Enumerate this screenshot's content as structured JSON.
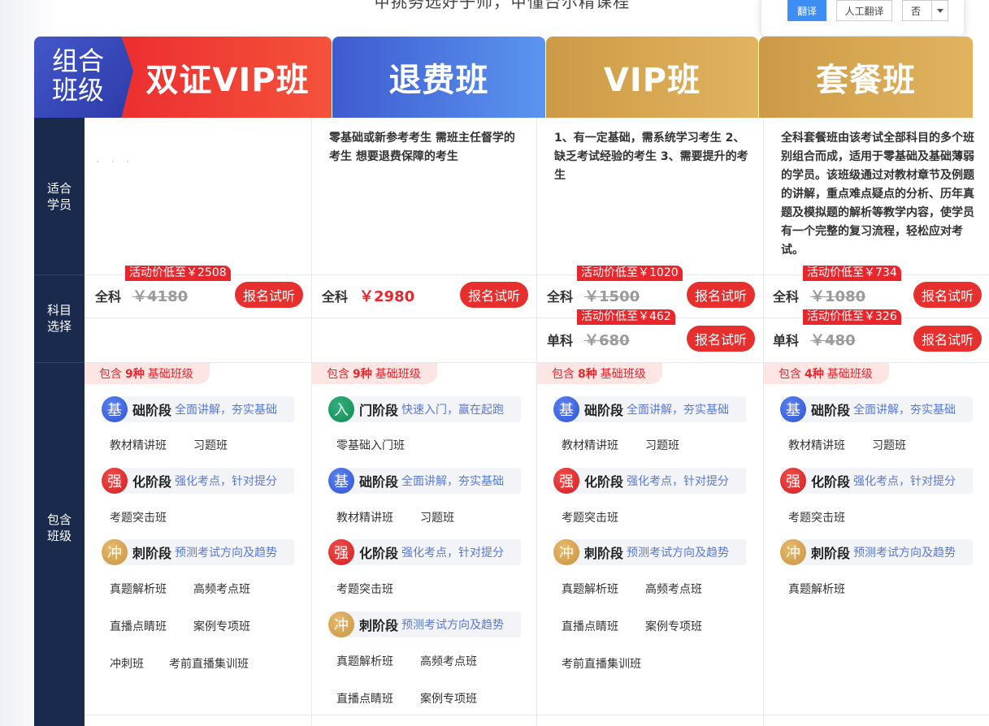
{
  "header": {
    "tagline": "甲挑务选好子师，甲懂台尔精课程"
  },
  "translate_popup": {
    "translate_label": "翻译",
    "human_label": "人工翻译",
    "select_value": "否"
  },
  "logo": {
    "line1": "组合",
    "line2": "班级"
  },
  "tabs": [
    "双证VIP班",
    "退费班",
    "VIP班",
    "套餐班"
  ],
  "row_labels": {
    "suitable": [
      "适合",
      "学员"
    ],
    "subject": [
      "科目",
      "选择"
    ],
    "classes": [
      "包含",
      "班级"
    ]
  },
  "columns": [
    {
      "suitable": "",
      "full_label": "全科",
      "full_orig": "￥4180",
      "full_promo": "活动价低至￥2508",
      "apply": "报名试听",
      "contains": {
        "pre": "包含",
        "count": "9种",
        "post": "基础班级"
      }
    },
    {
      "suitable": "零基础或新参考考生 需班主任督学的考生 想要退费保障的考生",
      "full_label": "全科",
      "full_price": "￥2980",
      "apply": "报名试听",
      "contains": {
        "pre": "包含",
        "count": "9种",
        "post": "基础班级"
      }
    },
    {
      "suitable": "1、有一定基础，需系统学习考生 2、缺乏考试经验的考生 3、需要提升的考生",
      "full_label": "全科",
      "full_orig": "￥1500",
      "full_promo": "活动价低至￥1020",
      "single_label": "单科",
      "single_orig": "￥680",
      "single_promo": "活动价低至￥462",
      "apply": "报名试听",
      "contains": {
        "pre": "包含",
        "count": "8种",
        "post": "基础班级"
      }
    },
    {
      "suitable": "全科套餐班由该考试全部科目的多个班别组合而成，适用于零基础及基础薄弱的学员。该班级通过对教材章节及例题的讲解，重点难点疑点的分析、历年真题及模拟题的解析等教学内容，使学员有一个完整的复习流程，轻松应对考试。",
      "full_label": "全科",
      "full_orig": "￥1080",
      "full_promo": "活动价低至￥734",
      "single_label": "单科",
      "single_orig": "￥480",
      "single_promo": "活动价低至￥326",
      "apply": "报名试听",
      "contains": {
        "pre": "包含",
        "count": "4种",
        "post": "基础班级"
      }
    }
  ],
  "stages": {
    "ji": {
      "icon": "基",
      "name": "础阶段",
      "desc": "全面讲解，夯实基础"
    },
    "qiang": {
      "icon": "强",
      "name": "化阶段",
      "desc": "强化考点，针对提分"
    },
    "chong": {
      "icon": "冲",
      "name": "刺阶段",
      "desc": "预测考试方向及趋势"
    },
    "ru": {
      "icon": "入",
      "name": "门阶段",
      "desc": "快速入门，赢在起跑"
    }
  },
  "courses": {
    "jiaocai": "教材精讲班",
    "xiti": "习题班",
    "kaoti": "考题突击班",
    "zhenti": "真题解析班",
    "gaopin": "高频考点班",
    "zhibo": "直播点睛班",
    "anli": "案例专项班",
    "chongci": "冲刺班",
    "kaoqian": "考前直播集训班",
    "lingjichu": "零基础入门班"
  }
}
